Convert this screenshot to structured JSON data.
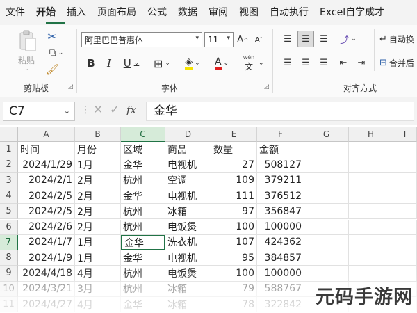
{
  "menubar": {
    "tabs": [
      {
        "label": "文件",
        "active": false
      },
      {
        "label": "开始",
        "active": true
      },
      {
        "label": "插入",
        "active": false
      },
      {
        "label": "页面布局",
        "active": false
      },
      {
        "label": "公式",
        "active": false
      },
      {
        "label": "数据",
        "active": false
      },
      {
        "label": "审阅",
        "active": false
      },
      {
        "label": "视图",
        "active": false
      },
      {
        "label": "自动执行",
        "active": false
      },
      {
        "label": "Excel自学成才",
        "active": false
      }
    ]
  },
  "ribbon": {
    "clipboard": {
      "label": "剪贴板",
      "paste_label": "粘贴"
    },
    "font": {
      "label": "字体",
      "font_name": "阿里巴巴普惠体",
      "font_size": "11",
      "bold": "B",
      "italic": "I",
      "underline": "U",
      "grow": "A",
      "shrink": "A",
      "wen": "wén",
      "wen_char": "文"
    },
    "alignment": {
      "label": "对齐方式",
      "wrap_label": "自动换",
      "merge_label": "合并后"
    }
  },
  "formula_bar": {
    "name_box": "C7",
    "fx": "fx",
    "content": "金华"
  },
  "grid": {
    "columns": [
      "A",
      "B",
      "C",
      "D",
      "E",
      "F",
      "G",
      "H",
      "I"
    ],
    "selected_column": "C",
    "selected_row": "7",
    "rows": [
      {
        "num": "1",
        "cells": [
          "时间",
          "月份",
          "区域",
          "商品",
          "数量",
          "金额"
        ]
      },
      {
        "num": "2",
        "cells": [
          "2024/1/29",
          "1月",
          "金华",
          "电视机",
          "27",
          "508127"
        ]
      },
      {
        "num": "3",
        "cells": [
          "2024/2/1",
          "2月",
          "杭州",
          "空调",
          "109",
          "379211"
        ]
      },
      {
        "num": "4",
        "cells": [
          "2024/2/5",
          "2月",
          "金华",
          "电视机",
          "111",
          "376512"
        ]
      },
      {
        "num": "5",
        "cells": [
          "2024/2/5",
          "2月",
          "杭州",
          "冰箱",
          "97",
          "356847"
        ]
      },
      {
        "num": "6",
        "cells": [
          "2024/2/6",
          "2月",
          "杭州",
          "电饭煲",
          "100",
          "100000"
        ]
      },
      {
        "num": "7",
        "cells": [
          "2024/1/7",
          "1月",
          "金华",
          "洗衣机",
          "107",
          "424362"
        ]
      },
      {
        "num": "8",
        "cells": [
          "2024/1/9",
          "1月",
          "金华",
          "电视机",
          "95",
          "384857"
        ]
      },
      {
        "num": "9",
        "cells": [
          "2024/4/18",
          "4月",
          "杭州",
          "电饭煲",
          "100",
          "100000"
        ]
      },
      {
        "num": "10",
        "cells": [
          "2024/3/21",
          "3月",
          "杭州",
          "冰箱",
          "79",
          "588767"
        ]
      },
      {
        "num": "11",
        "cells": [
          "2024/4/27",
          "4月",
          "金华",
          "冰箱",
          "78",
          "322842"
        ]
      }
    ]
  },
  "watermark": "元码手游网",
  "colors": {
    "accent": "#217346",
    "menubar_bg": "#f3f3f3",
    "header_bg": "#f0f0f0",
    "selected_header_bg": "#d6ebd9"
  }
}
